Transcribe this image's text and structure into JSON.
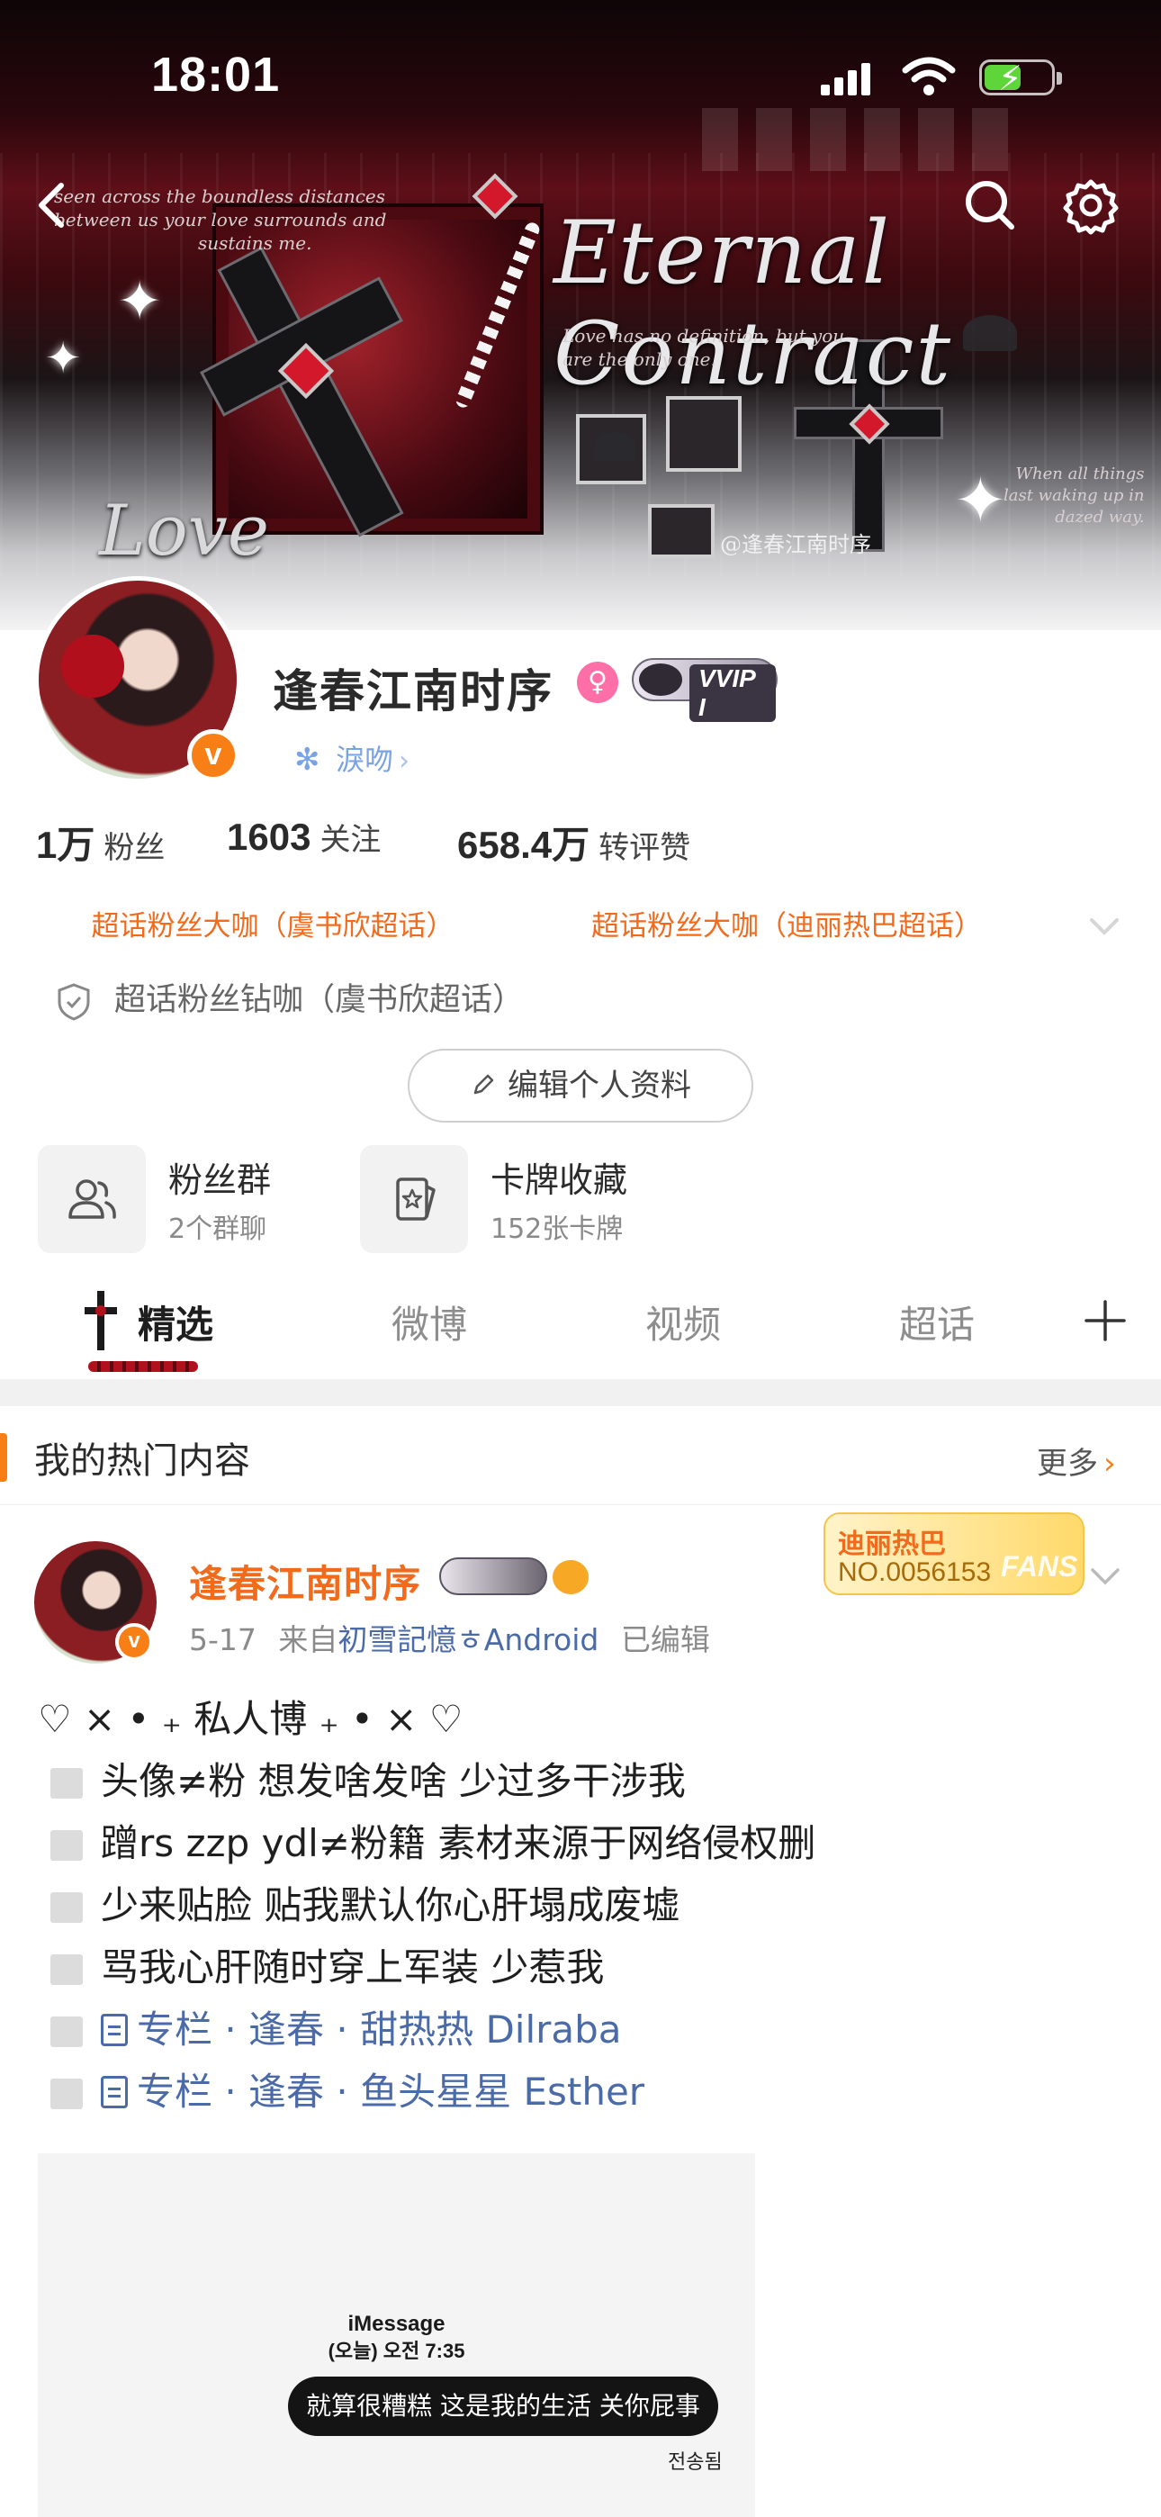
{
  "status_bar": {
    "time": "18:01",
    "battery_level": 0.55
  },
  "banner": {
    "title_art": "Eternal Contract",
    "love_art": "Love",
    "script_left": [
      "seen across the boundless distances",
      "between us your love surrounds and",
      "sustains me."
    ],
    "script_mid": [
      "Love has no definition, but you",
      "are the only one."
    ],
    "script_right": [
      "When all things",
      "last waking up in",
      "dazed way."
    ],
    "watermark": "@逢春江南时序"
  },
  "profile": {
    "name": "逢春江南时序",
    "vip_label": "VVIP I",
    "tag_label": "淚吻",
    "stats": [
      {
        "num": "1万",
        "label": "粉丝"
      },
      {
        "num": "1603",
        "label": "关注"
      },
      {
        "num": "658.4万",
        "label": "转评赞"
      }
    ],
    "chips": [
      "超话粉丝大咖（虞书欣超话）",
      "超话粉丝大咖（迪丽热巴超话）"
    ],
    "badge_line": "超话粉丝钻咖（虞书欣超话）",
    "edit_button": "编辑个人资料",
    "features": [
      {
        "title": "粉丝群",
        "sub": "2个群聊",
        "icon": "people-icon"
      },
      {
        "title": "卡牌收藏",
        "sub": "152张卡牌",
        "icon": "card-icon"
      }
    ]
  },
  "tabs": [
    "精选",
    "微博",
    "视频",
    "超话"
  ],
  "hot": {
    "title": "我的热门内容",
    "more": "更多"
  },
  "post": {
    "author": "逢春江南时序",
    "date": "5-17",
    "from_prefix": "来自",
    "source": "初雪記憶ㅎAndroid",
    "edited": "已编辑",
    "fan_card": {
      "name": "迪丽热巴",
      "number": "NO.0056153",
      "tag": "FANS"
    },
    "lines": [
      "♡ ⨯ • ₊ 私人博 ₊ • ⨯ ♡",
      "头像≠粉 想发啥发啥 少过多干涉我",
      "蹭rs zzp ydl≠粉籍 素材来源于网络侵权删",
      "少来贴脸 贴我默认你心肝塌成废墟",
      "骂我心肝随时穿上军装 少惹我"
    ],
    "links": [
      "专栏 · 逢春 · 甜热热 Dilraba",
      "专栏 · 逢春 · 鱼头星星 Esther"
    ],
    "image": {
      "app": "iMessage",
      "time": "(오늘) 오전 7:35",
      "bubble": "就算很糟糕 这是我的生活 关你屁事",
      "sign": "전송됨"
    }
  }
}
